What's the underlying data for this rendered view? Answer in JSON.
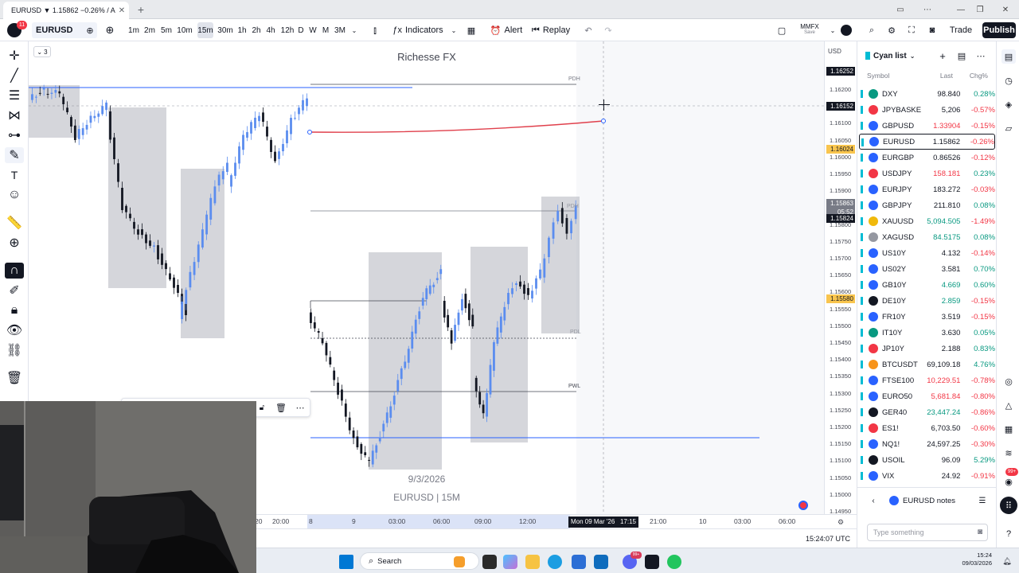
{
  "browser": {
    "tab_title": "EURUSD ▼ 1.15862 −0.26% / A",
    "new_tab": "+"
  },
  "toolbar": {
    "avatar_badge": "11",
    "symbol": "EURUSD",
    "intervals": [
      "1m",
      "2m",
      "5m",
      "10m",
      "15m",
      "30m",
      "1h",
      "2h",
      "4h",
      "12h",
      "D",
      "W",
      "M",
      "3M"
    ],
    "active_interval": "15m",
    "indicators": "Indicators",
    "alert": "Alert",
    "replay": "Replay",
    "layout_name": "MMFX",
    "layout_status": "Save",
    "trade": "Trade",
    "publish": "Publish"
  },
  "chart": {
    "title": "Richesse FX",
    "hide_count": "3",
    "watermark_date": "9/3/2026",
    "watermark_symbol": "EURUSD | 15M",
    "level_labels": {
      "pdh": "PDH",
      "pdl": "PDL",
      "pwl": "PWL",
      "pdh_right": "PDH"
    }
  },
  "price_axis": {
    "currency": "USD",
    "ticks": [
      "1.16200",
      "1.16150",
      "1.16100",
      "1.16050",
      "1.16000",
      "1.15950",
      "1.15900",
      "1.15850",
      "1.15800",
      "1.15750",
      "1.15700",
      "1.15650",
      "1.15600",
      "1.15550",
      "1.15500",
      "1.15450",
      "1.15400",
      "1.15350",
      "1.15300",
      "1.15250",
      "1.15200",
      "1.15150",
      "1.15100",
      "1.15050",
      "1.15000",
      "1.14950"
    ],
    "label_top": "1.16252",
    "label_cursor": "1.16152",
    "label_orange": "1.16024",
    "label_current": "1.15863",
    "label_countdown": "05:52",
    "label_dark": "1.15824",
    "label_orange2": "1.15580"
  },
  "time_axis": {
    "ticks": [
      "20",
      "20:00",
      "8",
      "9",
      "03:00",
      "06:00",
      "09:00",
      "12:00",
      "21:00",
      "10",
      "03:00",
      "06:00"
    ],
    "cursor_label": "Mon 09 Mar '26   17:15"
  },
  "bottom": {
    "clock": "15:24:07 UTC"
  },
  "watchlist": {
    "title": "Cyan list",
    "col_symbol": "Symbol",
    "col_last": "Last",
    "col_chg": "Chg%",
    "rows": [
      {
        "sym": "DXY",
        "last": "98.840",
        "chg": "0.28%",
        "dir": "pos",
        "color": "#089981"
      },
      {
        "sym": "JPYBASKET",
        "last": "5,206",
        "chg": "-0.57%",
        "dir": "neg",
        "color": "#f23645"
      },
      {
        "sym": "GBPUSD",
        "last": "1.33904",
        "chg": "-0.15%",
        "dir": "neg",
        "color": "#2962ff",
        "last_color": "neg"
      },
      {
        "sym": "EURUSD",
        "last": "1.15862",
        "chg": "-0.26%",
        "dir": "neg",
        "color": "#2962ff"
      },
      {
        "sym": "EURGBP",
        "last": "0.86526",
        "chg": "-0.12%",
        "dir": "neg",
        "color": "#2962ff"
      },
      {
        "sym": "USDJPY",
        "last": "158.181",
        "chg": "0.23%",
        "dir": "pos",
        "color": "#f23645",
        "last_color": "neg"
      },
      {
        "sym": "EURJPY",
        "last": "183.272",
        "chg": "-0.03%",
        "dir": "neg",
        "color": "#2962ff"
      },
      {
        "sym": "GBPJPY",
        "last": "211.810",
        "chg": "0.08%",
        "dir": "pos",
        "color": "#2962ff"
      },
      {
        "sym": "XAUUSD",
        "last": "5,094.505",
        "chg": "-1.49%",
        "dir": "neg",
        "color": "#f0b90b",
        "last_color": "pos"
      },
      {
        "sym": "XAGUSD",
        "last": "84.5175",
        "chg": "0.08%",
        "dir": "pos",
        "color": "#9598a1",
        "last_color": "pos"
      },
      {
        "sym": "US10Y",
        "last": "4.132",
        "chg": "-0.14%",
        "dir": "neg",
        "color": "#2962ff"
      },
      {
        "sym": "US02Y",
        "last": "3.581",
        "chg": "0.70%",
        "dir": "pos",
        "color": "#2962ff"
      },
      {
        "sym": "GB10Y",
        "last": "4.669",
        "chg": "0.60%",
        "dir": "pos",
        "color": "#2962ff",
        "last_color": "pos"
      },
      {
        "sym": "DE10Y",
        "last": "2.859",
        "chg": "-0.15%",
        "dir": "neg",
        "color": "#131722",
        "last_color": "pos"
      },
      {
        "sym": "FR10Y",
        "last": "3.519",
        "chg": "-0.15%",
        "dir": "neg",
        "color": "#2962ff"
      },
      {
        "sym": "IT10Y",
        "last": "3.630",
        "chg": "0.05%",
        "dir": "pos",
        "color": "#089981"
      },
      {
        "sym": "JP10Y",
        "last": "2.188",
        "chg": "0.83%",
        "dir": "pos",
        "color": "#f23645"
      },
      {
        "sym": "BTCUSDT",
        "last": "69,109.18",
        "chg": "4.76%",
        "dir": "pos",
        "color": "#f7931a"
      },
      {
        "sym": "FTSE100",
        "last": "10,229.51",
        "chg": "-0.78%",
        "dir": "neg",
        "color": "#2962ff",
        "last_color": "neg"
      },
      {
        "sym": "EURO50",
        "last": "5,681.84",
        "chg": "-0.80%",
        "dir": "neg",
        "color": "#2962ff",
        "last_color": "neg"
      },
      {
        "sym": "GER40",
        "last": "23,447.24",
        "chg": "-0.86%",
        "dir": "neg",
        "color": "#131722",
        "last_color": "pos"
      },
      {
        "sym": "ES1!",
        "last": "6,703.50",
        "chg": "-0.60%",
        "dir": "neg",
        "color": "#f23645"
      },
      {
        "sym": "NQ1!",
        "last": "24,597.25",
        "chg": "-0.30%",
        "dir": "neg",
        "color": "#2962ff"
      },
      {
        "sym": "USOIL",
        "last": "96.09",
        "chg": "5.29%",
        "dir": "pos",
        "color": "#131722"
      },
      {
        "sym": "VIX",
        "last": "24.92",
        "chg": "-0.91%",
        "dir": "neg",
        "color": "#2962ff"
      }
    ],
    "notes_title": "EURUSD notes",
    "notes_placeholder": "Type something"
  },
  "rightbar": {
    "badge": "99+"
  },
  "taskbar": {
    "search": "Search",
    "time": "15:24",
    "date": "09/03/2026",
    "badge": "99+"
  },
  "colors": {
    "bull": "#5b8def",
    "bear": "#131722",
    "zone": "#b2b5be",
    "accent": "#2962ff",
    "red_line": "#e0404c"
  }
}
